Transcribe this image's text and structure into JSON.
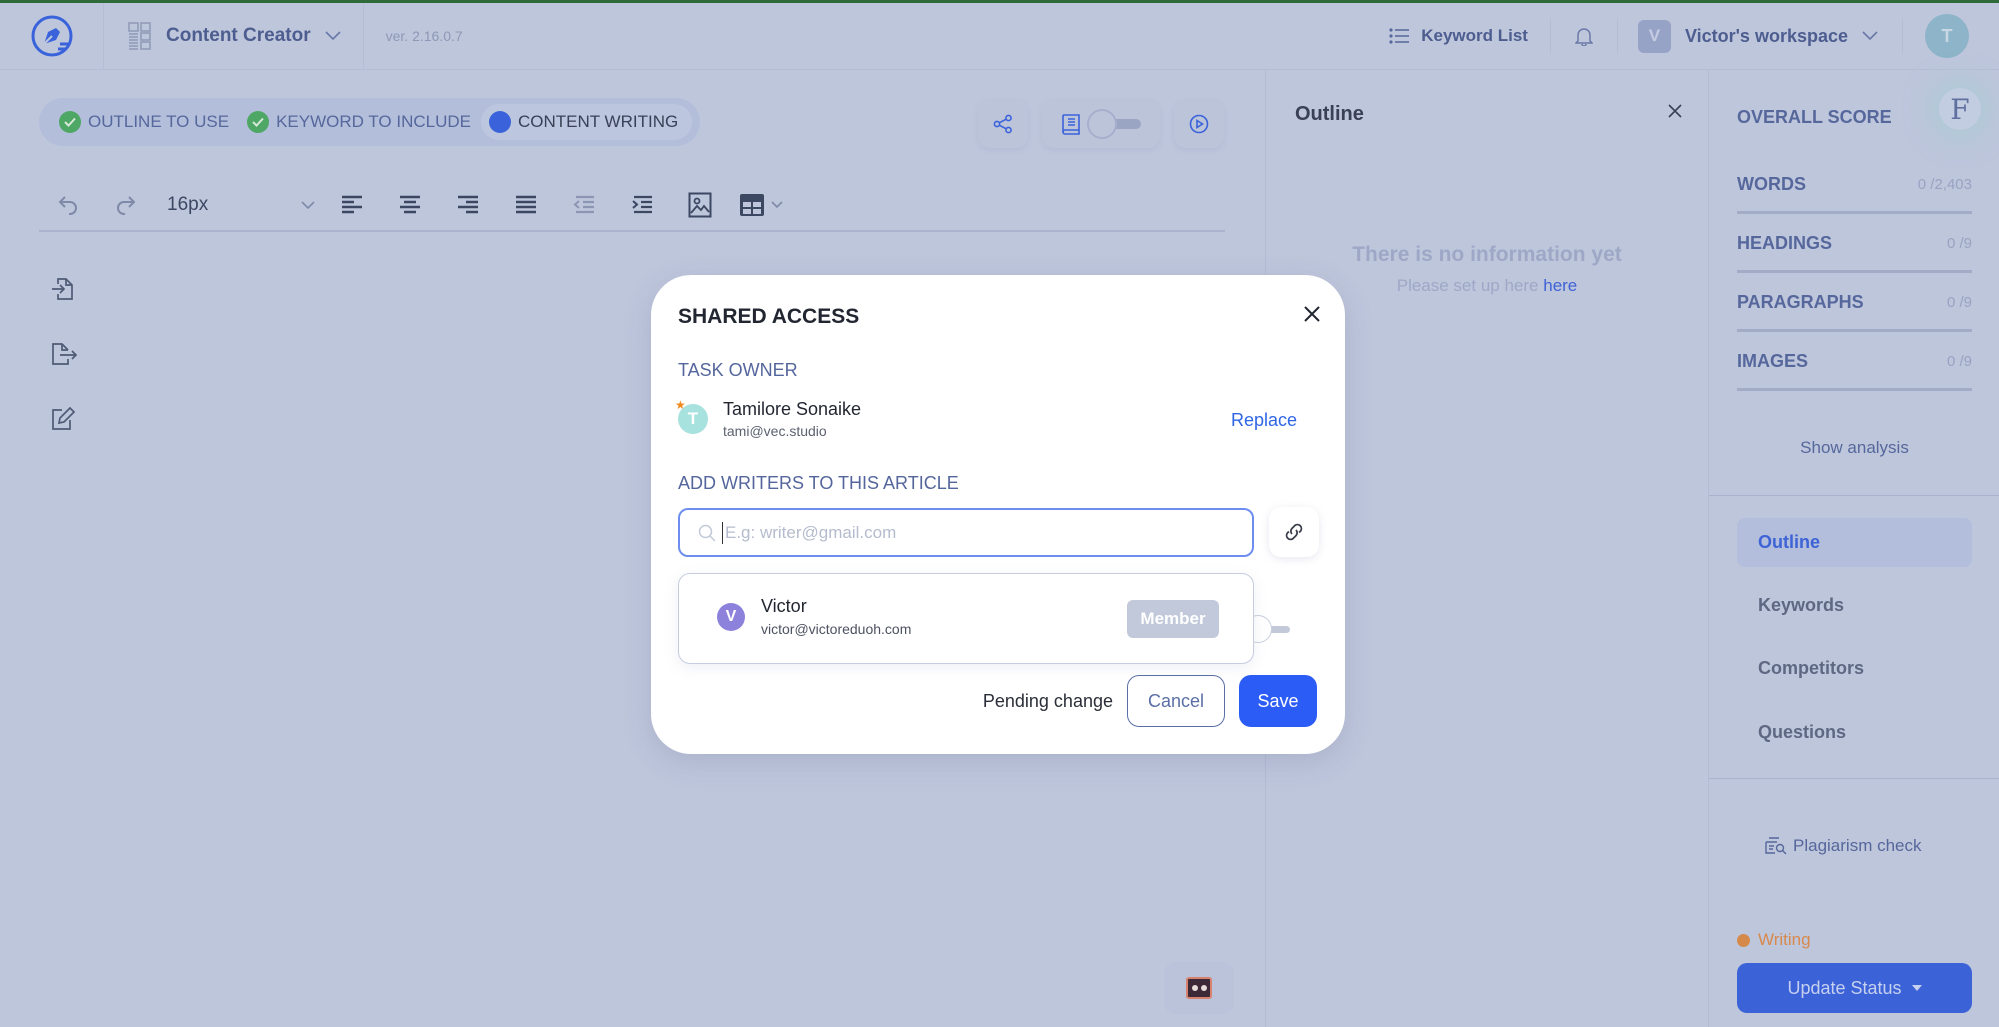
{
  "topbar": {
    "app_name": "Content Creator",
    "version": "ver. 2.16.0.7",
    "keyword_list": "Keyword List",
    "workspace_initial": "V",
    "workspace_name": "Victor's workspace",
    "user_initial": "T"
  },
  "steps": [
    {
      "label": "OUTLINE TO USE",
      "state": "done"
    },
    {
      "label": "KEYWORD TO INCLUDE",
      "state": "done"
    },
    {
      "label": "CONTENT WRITING",
      "state": "active"
    }
  ],
  "editor": {
    "font_size": "16px"
  },
  "outline_panel": {
    "title": "Outline",
    "empty_title": "There is no information yet",
    "empty_sub": "Please set up here",
    "empty_link": "here"
  },
  "score_panel": {
    "overall_label": "OVERALL SCORE",
    "grade": "F",
    "metrics": [
      {
        "label": "WORDS",
        "value": "0 /2,403"
      },
      {
        "label": "HEADINGS",
        "value": "0 /9"
      },
      {
        "label": "PARAGRAPHS",
        "value": "0 /9"
      },
      {
        "label": "IMAGES",
        "value": "0 /9"
      }
    ],
    "show_analysis": "Show analysis",
    "nav": [
      {
        "label": "Outline",
        "active": true
      },
      {
        "label": "Keywords",
        "active": false
      },
      {
        "label": "Competitors",
        "active": false
      },
      {
        "label": "Questions",
        "active": false
      }
    ],
    "plagiarism": "Plagiarism check",
    "status": "Writing",
    "update_status": "Update Status"
  },
  "modal": {
    "title": "SHARED ACCESS",
    "owner_label": "TASK OWNER",
    "owner": {
      "initial": "T",
      "name": "Tamilore Sonaike",
      "email": "tami@vec.studio"
    },
    "replace": "Replace",
    "writers_label": "ADD WRITERS TO THIS ARTICLE",
    "writer_input": {
      "value": "",
      "placeholder": "E.g: writer@gmail.com"
    },
    "suggestions": [
      {
        "initial": "V",
        "name": "Victor",
        "email": "victor@victoreduoh.com",
        "role": "Member"
      }
    ],
    "pending": "Pending change",
    "cancel": "Cancel",
    "save": "Save"
  },
  "colors": {
    "accent": "#2b5cf5",
    "overlay": "#bec6dc",
    "done": "#4ea764",
    "status_writing": "#d58a4c"
  }
}
